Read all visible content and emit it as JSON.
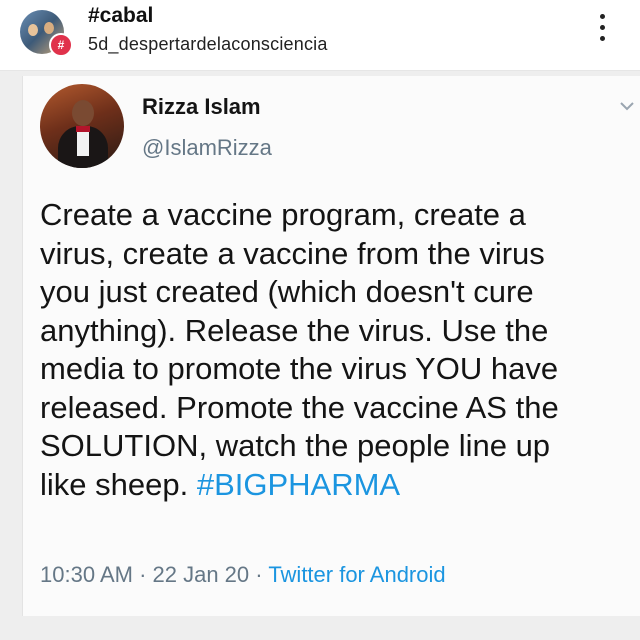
{
  "post": {
    "title": "#cabal",
    "username": "5d_despertardelaconsciencia",
    "badge_glyph": "#",
    "more_icon": "more-vertical-icon"
  },
  "tweet": {
    "name": "Rizza Islam",
    "handle": "@IslamRizza",
    "body": "Create a vaccine program,  create a\nvirus, create a vaccine from the virus\nyou just created (which doesn't cure\nanything). Release the virus. Use the\nmedia to promote the virus YOU have\nreleased. Promote the vaccine AS the\nSOLUTION, watch the people line up\nlike sheep. ",
    "hashtag": "#BIGPHARMA",
    "time": "10:30 AM",
    "sep1": " · ",
    "date": "22 Jan 20",
    "sep2": " · ",
    "source": "Twitter for Android",
    "hashtag_color": "#1b95e0",
    "handle_color": "#657786"
  }
}
